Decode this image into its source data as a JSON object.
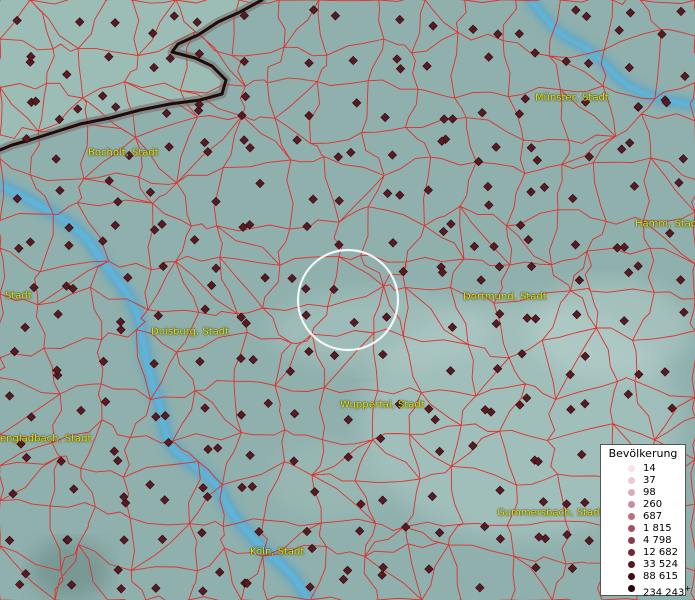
{
  "cities": [
    {
      "id": "muenster",
      "label": "Münster, Stadt"
    },
    {
      "id": "bocholt",
      "label": "Bocholt, Stadt"
    },
    {
      "id": "hamm",
      "label": "Hamm, Stadt"
    },
    {
      "id": "edge-stadt",
      "label": "Stadt"
    },
    {
      "id": "duisburg",
      "label": "Duisburg, Stadt"
    },
    {
      "id": "dortmund",
      "label": "Dortmund, Stadt"
    },
    {
      "id": "wuppertal",
      "label": "Wuppertal, Stadt"
    },
    {
      "id": "moenchengladbach",
      "label": "engladbach, Stadt"
    },
    {
      "id": "gummersbach",
      "label": "Gummersbach, Stadt"
    },
    {
      "id": "koeln",
      "label": "Köln, Stadt"
    }
  ],
  "legend": {
    "title": "Bevölkerung",
    "entries": [
      {
        "label": "14",
        "color": "#f7e4ea"
      },
      {
        "label": "37",
        "color": "#eccad3"
      },
      {
        "label": "98",
        "color": "#ddabb7"
      },
      {
        "label": "260",
        "color": "#cb8c9b"
      },
      {
        "label": "687",
        "color": "#b86e80"
      },
      {
        "label": "1 815",
        "color": "#a35265"
      },
      {
        "label": "4 798",
        "color": "#8b3a4d"
      },
      {
        "label": "12 682",
        "color": "#722636"
      },
      {
        "label": "33 524",
        "color": "#581724"
      },
      {
        "label": "88 615",
        "color": "#3f0c16"
      },
      {
        "label": "234 243",
        "color": "#25040a",
        "suffix": "+"
      }
    ]
  },
  "colors": {
    "background": "#8fb0ad",
    "boundaries": "#e0302a",
    "rivers": "#58a6cc",
    "state_border": "#1c0c0c",
    "marker": "#5a1a22",
    "city_label": "#e8e400",
    "focus_ring": "#ffffff"
  },
  "map": {
    "markers_visible": true,
    "focus_ring_visible": true
  }
}
